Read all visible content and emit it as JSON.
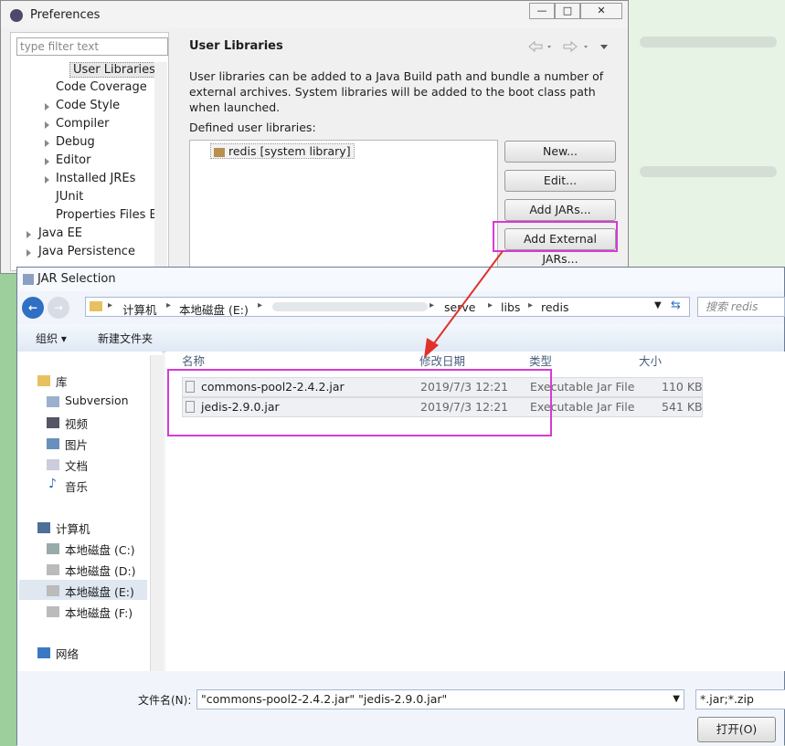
{
  "preferences": {
    "title": "Preferences",
    "filter_placeholder": "type filter text",
    "tree": {
      "selected": "User Libraries",
      "items": [
        "Code Coverage",
        "Code Style",
        "Compiler",
        "Debug",
        "Editor",
        "Installed JREs",
        "JUnit",
        "Properties Files Ed"
      ],
      "root_items": [
        "Java EE",
        "Java Persistence"
      ]
    },
    "page_title": "User Libraries",
    "description": "User libraries can be added to a Java Build path and bundle a number of external archives. System libraries will be added to the boot class path when launched.",
    "defined_label": "Defined user libraries:",
    "libraries": [
      "redis [system library]"
    ],
    "buttons": [
      "New...",
      "Edit...",
      "Add JARs...",
      "Add External JARs..."
    ]
  },
  "jar_dialog": {
    "title": "JAR Selection",
    "breadcrumbs": [
      "计算机",
      "本地磁盘 (E:)",
      "serve",
      "libs",
      "redis"
    ],
    "search_placeholder": "搜索 redis",
    "toolbar": {
      "organize": "组织 ▾",
      "new_folder": "新建文件夹"
    },
    "sidebar": {
      "library": "库",
      "library_items": [
        "Subversion",
        "视频",
        "图片",
        "文档",
        "音乐"
      ],
      "computer": "计算机",
      "drives": [
        "本地磁盘 (C:)",
        "本地磁盘 (D:)",
        "本地磁盘 (E:)",
        "本地磁盘 (F:)"
      ],
      "network": "网络"
    },
    "columns": [
      "名称",
      "修改日期",
      "类型",
      "大小"
    ],
    "files": [
      {
        "name": "commons-pool2-2.4.2.jar",
        "date": "2019/7/3 12:21",
        "type": "Executable Jar File",
        "size": "110 KB"
      },
      {
        "name": "jedis-2.9.0.jar",
        "date": "2019/7/3 12:21",
        "type": "Executable Jar File",
        "size": "541 KB"
      }
    ],
    "filename_label": "文件名(N):",
    "filename_value": "\"commons-pool2-2.4.2.jar\" \"jedis-2.9.0.jar\"",
    "filetype_value": "*.jar;*.zip",
    "open_button": "打开(O)"
  },
  "colors": {
    "highlight": "#d63ad6",
    "arrow": "#e0322b",
    "selection": "#cce8ff"
  }
}
